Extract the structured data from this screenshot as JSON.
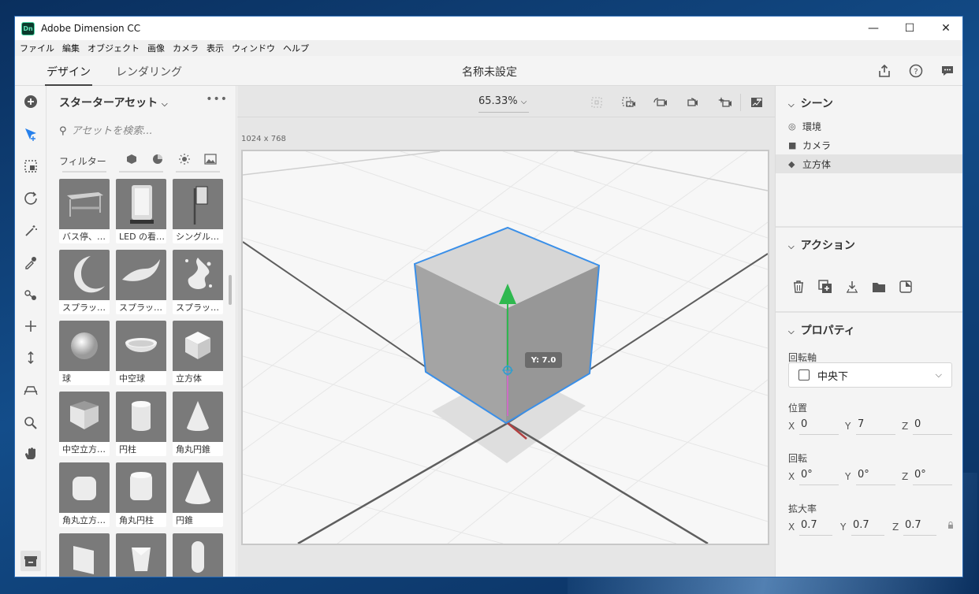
{
  "window": {
    "title": "Adobe Dimension CC",
    "icon_text": "Dn"
  },
  "menu": [
    "ファイル",
    "編集",
    "オブジェクト",
    "画像",
    "カメラ",
    "表示",
    "ウィンドウ",
    "ヘルプ"
  ],
  "tabs": {
    "design": "デザイン",
    "render": "レンダリング"
  },
  "document_title": "名称未設定",
  "assets": {
    "title": "スターターアセット",
    "search_placeholder": "アセットを検索...",
    "filter_label": "フィルター",
    "items": [
      {
        "label": "バス停、…",
        "shape": "bench"
      },
      {
        "label": "LED の看…",
        "shape": "sign"
      },
      {
        "label": "シングル…",
        "shape": "post"
      },
      {
        "label": "スプラッ…",
        "shape": "splash1"
      },
      {
        "label": "スプラッ…",
        "shape": "splash2"
      },
      {
        "label": "スプラッ…",
        "shape": "splash3"
      },
      {
        "label": "球",
        "shape": "sphere"
      },
      {
        "label": "中空球",
        "shape": "bowl"
      },
      {
        "label": "立方体",
        "shape": "cube"
      },
      {
        "label": "中空立方…",
        "shape": "hollowcube"
      },
      {
        "label": "円柱",
        "shape": "cylinder"
      },
      {
        "label": "角丸円錐",
        "shape": "roundcone"
      },
      {
        "label": "角丸立方…",
        "shape": "roundcube"
      },
      {
        "label": "角丸円柱",
        "shape": "roundcyl"
      },
      {
        "label": "円錐",
        "shape": "cone"
      },
      {
        "label": "",
        "shape": "wedge"
      },
      {
        "label": "",
        "shape": "prism"
      },
      {
        "label": "",
        "shape": "capsule"
      }
    ]
  },
  "viewport": {
    "zoom": "65.33%",
    "resolution": "1024 x 768",
    "tooltip": "Y: 7.0"
  },
  "scene": {
    "title": "シーン",
    "items": [
      "環境",
      "カメラ",
      "立方体"
    ]
  },
  "actions": {
    "title": "アクション"
  },
  "properties": {
    "title": "プロパティ",
    "pivot_label": "回転軸",
    "pivot_value": "中央下",
    "position_label": "位置",
    "position": {
      "x": "0",
      "y": "7",
      "z": "0"
    },
    "rotation_label": "回転",
    "rotation": {
      "x": "0°",
      "y": "0°",
      "z": "0°"
    },
    "scale_label": "拡大率",
    "scale": {
      "x": "0.7",
      "y": "0.7",
      "z": "0.7"
    },
    "axis_labels": {
      "x": "X",
      "y": "Y",
      "z": "Z"
    }
  },
  "colors": {
    "accent": "#2680eb",
    "gizmo_green": "#2fb84f",
    "gizmo_pink": "#e05cd6",
    "selection": "#3a8fe8"
  }
}
